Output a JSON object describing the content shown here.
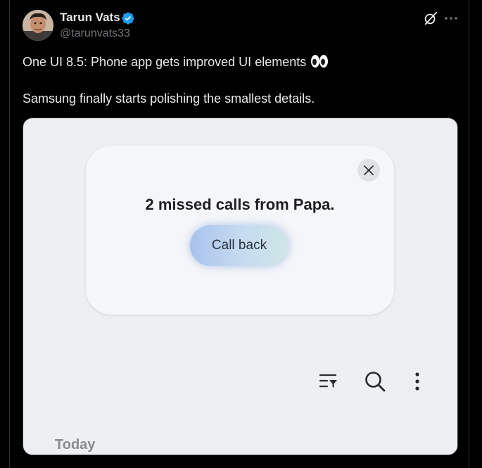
{
  "author": {
    "name": "Tarun Vats",
    "handle": "@tarunvats33",
    "verified": true
  },
  "tweet": {
    "line1": "One UI 8.5: Phone app gets improved UI elements",
    "line1_emoji": "eyes-emoji",
    "line2": "Samsung finally starts polishing the smallest details."
  },
  "header_icons": [
    "grok-icon",
    "more-icon"
  ],
  "media": {
    "notification": {
      "message": "2 missed calls from Papa.",
      "action_label": "Call back",
      "close_icon": "close-icon"
    },
    "toolbar_icons": [
      "filter-icon",
      "search-icon",
      "more-vertical-icon"
    ],
    "section_label": "Today"
  },
  "colors": {
    "background": "#000000",
    "text_primary": "#e7e9ea",
    "text_secondary": "#71767b",
    "verified_badge": "#1d9bf0",
    "media_background": "#eeeff2",
    "callback_gradient_start": "#a9c2ec",
    "callback_gradient_end": "#cfe5e6"
  }
}
